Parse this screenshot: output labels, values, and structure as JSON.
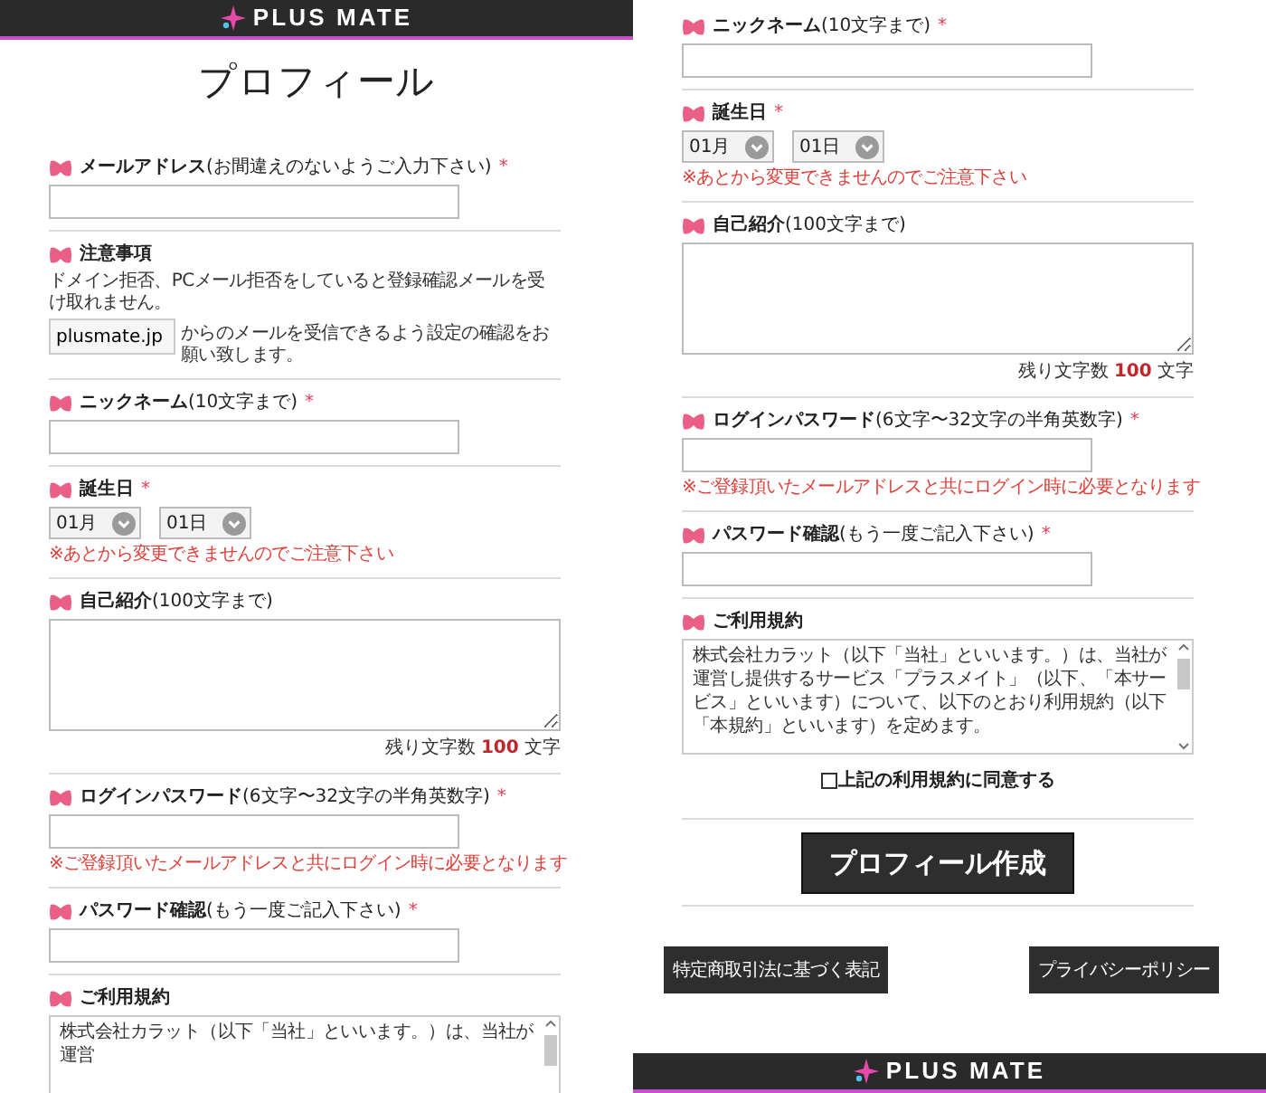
{
  "screens": [
    {
      "header": {
        "logo": "PLUS MATE"
      },
      "title": "プロフィール",
      "sections": [
        {
          "kind": "field",
          "label": "メールアドレス",
          "hint": "(お間違えのないようご入力下さい)",
          "mark": "*"
        },
        {
          "kind": "notice",
          "label": "注意事項",
          "text": "ドメイン拒否、PCメール拒否をしていると登録確認メールを受け取れません。",
          "domain": "plusmate.jp",
          "text_after": "からのメールを受信できるよう設定の確認をお願い致します。"
        },
        {
          "kind": "field",
          "label": "ニックネーム",
          "hint": "(10文字まで)",
          "mark": "*"
        },
        {
          "kind": "birthday",
          "label": "誕生日",
          "mark": "*",
          "selects": [
            "01月",
            "01日"
          ],
          "note": "※あとから変更できませんのでご注意下さい"
        },
        {
          "kind": "textarea",
          "label": "自己紹介",
          "hint": "(100文字まで)",
          "counter": {
            "prefix": "残り文字数",
            "count": "100",
            "suffix": "文字"
          }
        },
        {
          "kind": "field",
          "label": "ログインパスワード",
          "hint": "(6文字〜32文字の半角英数字)",
          "mark": "*",
          "note": "※ご登録頂いたメールアドレスと共にログイン時に必要となります"
        },
        {
          "kind": "field",
          "label": "パスワード確認",
          "hint": "(もう一度ご記入下さい)",
          "mark": "*"
        },
        {
          "kind": "terms",
          "label": "ご利用規約",
          "text": "株式会社カラット（以下「当社」といいます。）は、当社が運営"
        }
      ]
    },
    {
      "sections": [
        {
          "kind": "field",
          "label": "ニックネーム",
          "hint": "(10文字まで)",
          "mark": "*"
        },
        {
          "kind": "birthday",
          "label": "誕生日",
          "mark": "*",
          "selects": [
            "01月",
            "01日"
          ],
          "note": "※あとから変更できませんのでご注意下さい"
        },
        {
          "kind": "textarea",
          "label": "自己紹介",
          "hint": "(100文字まで)",
          "counter": {
            "prefix": "残り文字数",
            "count": "100",
            "suffix": "文字"
          }
        },
        {
          "kind": "field",
          "label": "ログインパスワード",
          "hint": "(6文字〜32文字の半角英数字)",
          "mark": "*",
          "note": "※ご登録頂いたメールアドレスと共にログイン時に必要となります"
        },
        {
          "kind": "field",
          "label": "パスワード確認",
          "hint": "(もう一度ご記入下さい)",
          "mark": "*"
        },
        {
          "kind": "terms",
          "label": "ご利用規約",
          "text": "株式会社カラット（以下「当社」といいます。）は、当社が運営し提供するサービス「プラスメイト」（以下、「本サービス」といいます）について、以下のとおり利用規約（以下「本規約」といいます）を定めます。",
          "agree": {
            "label": "上記の利用規約に同意する",
            "checked": false
          }
        },
        {
          "kind": "submit",
          "label": "プロフィール作成"
        },
        {
          "kind": "links",
          "items": [
            "特定商取引法に基づく表記",
            "プライバシーポリシー"
          ]
        }
      ],
      "footer": {
        "logo": "PLUS MATE"
      }
    }
  ]
}
